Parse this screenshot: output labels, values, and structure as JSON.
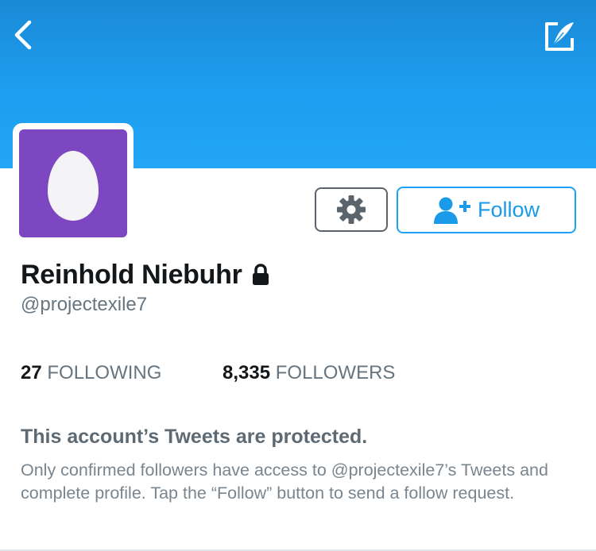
{
  "header": {
    "background_color": "#1da1f2",
    "back_icon": "chevron-left-icon",
    "compose_icon": "compose-tweet-icon"
  },
  "profile": {
    "avatar_color": "#7e47c2",
    "avatar_icon": "default-egg-avatar",
    "display_name": "Reinhold Niebuhr",
    "protected_icon": "lock-icon",
    "handle": "@projectexile7"
  },
  "actions": {
    "settings_icon": "gear-icon",
    "follow_icon": "add-user-icon",
    "follow_label": "Follow"
  },
  "stats": {
    "following_count": "27",
    "following_label": "FOLLOWING",
    "followers_count": "8,335",
    "followers_label": "FOLLOWERS"
  },
  "protected_notice": {
    "title": "This account’s Tweets are protected.",
    "body": "Only confirmed followers have access to @projectexile7’s Tweets and complete profile. Tap the “Follow” button to send a follow request."
  }
}
